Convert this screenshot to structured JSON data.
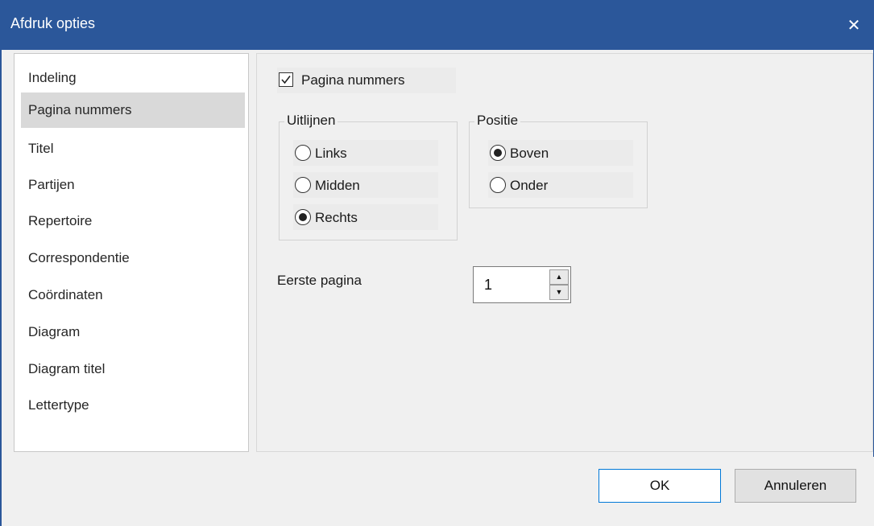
{
  "window": {
    "title": "Afdruk opties",
    "close_glyph": "✕"
  },
  "sidebar": {
    "items": [
      {
        "label": "Indeling",
        "selected": false
      },
      {
        "label": "Pagina nummers",
        "selected": true
      },
      {
        "label": "Titel",
        "selected": false
      },
      {
        "label": "Partijen",
        "selected": false
      },
      {
        "label": "Repertoire",
        "selected": false
      },
      {
        "label": "Correspondentie",
        "selected": false
      },
      {
        "label": "Coördinaten",
        "selected": false
      },
      {
        "label": "Diagram",
        "selected": false
      },
      {
        "label": "Diagram titel",
        "selected": false
      },
      {
        "label": "Lettertype",
        "selected": false
      }
    ]
  },
  "content": {
    "page_numbers_checkbox": {
      "label": "Pagina nummers",
      "checked": true
    },
    "align_group": {
      "title": "Uitlijnen",
      "options": [
        {
          "label": "Links",
          "checked": false
        },
        {
          "label": "Midden",
          "checked": false
        },
        {
          "label": "Rechts",
          "checked": true
        }
      ]
    },
    "position_group": {
      "title": "Positie",
      "options": [
        {
          "label": "Boven",
          "checked": true
        },
        {
          "label": "Onder",
          "checked": false
        }
      ]
    },
    "first_page": {
      "label": "Eerste pagina",
      "value": "1",
      "up_glyph": "▲",
      "down_glyph": "▼"
    }
  },
  "footer": {
    "ok_label": "OK",
    "cancel_label": "Annuleren"
  },
  "colors": {
    "titlebar": "#2b579a",
    "selected_item": "#d9d9d9",
    "focus_border": "#0078d7"
  }
}
